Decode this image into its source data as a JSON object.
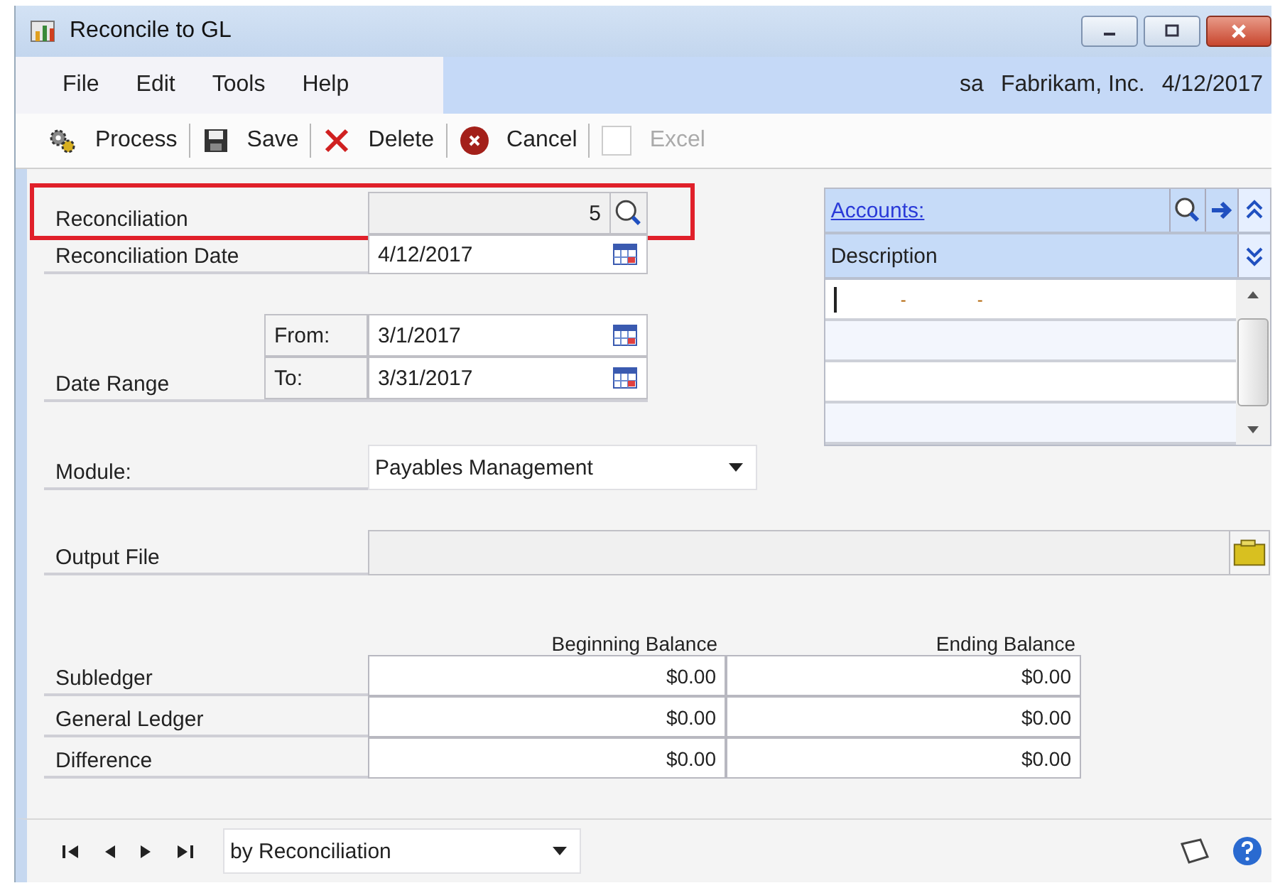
{
  "window": {
    "title": "Reconcile to GL"
  },
  "menu": [
    "File",
    "Edit",
    "Tools",
    "Help"
  ],
  "session": {
    "user": "sa",
    "company": "Fabrikam, Inc.",
    "date": "4/12/2017"
  },
  "toolbar": [
    {
      "label": "Process",
      "kind": "process",
      "disabled": false
    },
    {
      "label": "Save",
      "kind": "save",
      "disabled": false
    },
    {
      "label": "Delete",
      "kind": "delete",
      "disabled": false
    },
    {
      "label": "Cancel",
      "kind": "cancel",
      "disabled": false
    },
    {
      "label": "Excel",
      "kind": "excel",
      "disabled": true
    }
  ],
  "reconciliation": {
    "label": "Reconciliation",
    "value": "5",
    "highlighted": true
  },
  "reconciliation_date": {
    "label": "Reconciliation Date",
    "value": "4/12/2017"
  },
  "date_range": {
    "label": "Date Range",
    "from_label": "From:",
    "from": "3/1/2017",
    "to_label": "To:",
    "to": "3/31/2017"
  },
  "module": {
    "label": "Module:",
    "value": "Payables Management"
  },
  "output_file": {
    "label": "Output File"
  },
  "accounts": {
    "title": "Accounts:",
    "column": "Description",
    "first_row_segments": [
      "-",
      "-"
    ]
  },
  "balances": {
    "columns": [
      "Beginning Balance",
      "Ending Balance"
    ],
    "rows": [
      {
        "label": "Subledger",
        "values": [
          "$0.00",
          "$0.00"
        ]
      },
      {
        "label": "General Ledger",
        "values": [
          "$0.00",
          "$0.00"
        ]
      },
      {
        "label": "Difference",
        "values": [
          "$0.00",
          "$0.00"
        ]
      }
    ]
  },
  "footer": {
    "sort": "by Reconciliation"
  }
}
